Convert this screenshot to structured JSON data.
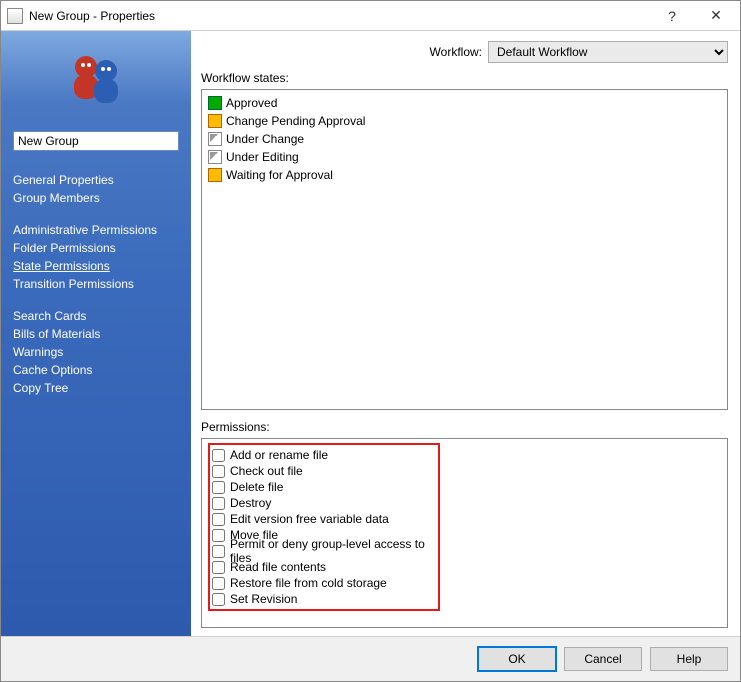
{
  "window": {
    "title": "New Group - Properties"
  },
  "sidebar": {
    "group_name": "New Group",
    "groupA": [
      {
        "label": "General Properties"
      },
      {
        "label": "Group Members"
      }
    ],
    "groupB": [
      {
        "label": "Administrative Permissions"
      },
      {
        "label": "Folder Permissions"
      },
      {
        "label": "State Permissions",
        "active": true
      },
      {
        "label": "Transition Permissions"
      }
    ],
    "groupC": [
      {
        "label": "Search Cards"
      },
      {
        "label": "Bills of Materials"
      },
      {
        "label": "Warnings"
      },
      {
        "label": "Cache Options"
      },
      {
        "label": "Copy Tree"
      }
    ]
  },
  "workflow": {
    "label": "Workflow:",
    "selected": "Default Workflow"
  },
  "states": {
    "label": "Workflow states:",
    "items": [
      {
        "label": "Approved",
        "icon": "approved"
      },
      {
        "label": "Change Pending Approval",
        "icon": "pending"
      },
      {
        "label": "Under Change",
        "icon": "editing"
      },
      {
        "label": "Under Editing",
        "icon": "editing"
      },
      {
        "label": "Waiting for Approval",
        "icon": "pending"
      }
    ]
  },
  "permissions": {
    "label": "Permissions:",
    "items": [
      {
        "label": "Add or rename file"
      },
      {
        "label": "Check out file"
      },
      {
        "label": "Delete file"
      },
      {
        "label": "Destroy"
      },
      {
        "label": "Edit version free variable data"
      },
      {
        "label": "Move file"
      },
      {
        "label": "Permit or deny group-level access to files"
      },
      {
        "label": "Read file contents"
      },
      {
        "label": "Restore file from cold storage"
      },
      {
        "label": "Set Revision"
      }
    ]
  },
  "footer": {
    "ok": "OK",
    "cancel": "Cancel",
    "help": "Help"
  }
}
